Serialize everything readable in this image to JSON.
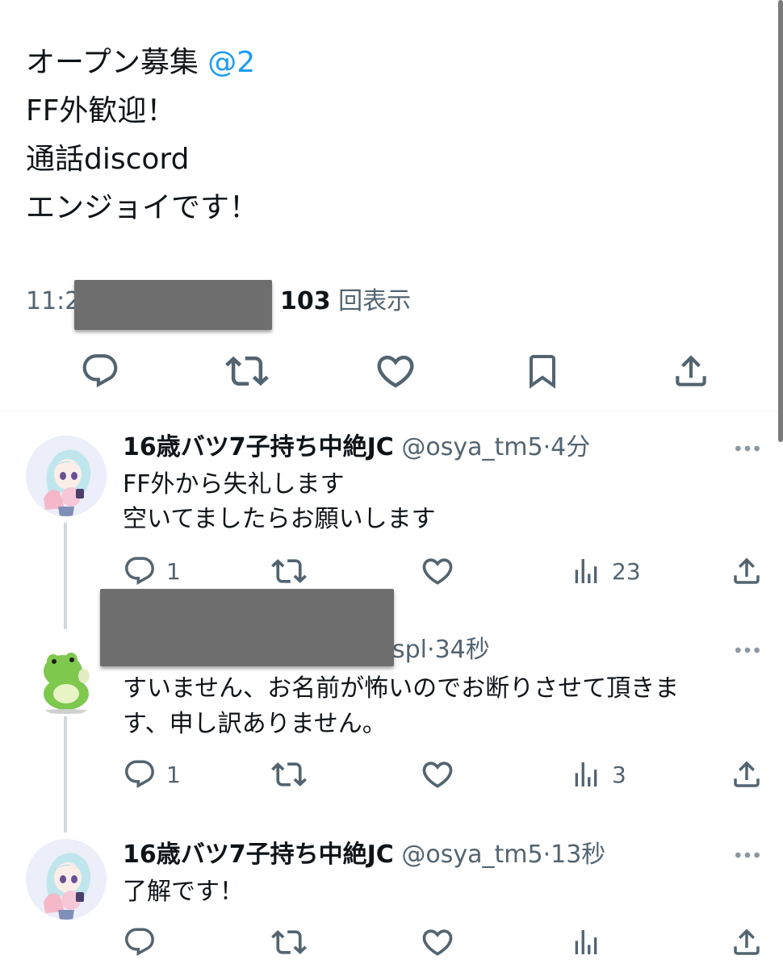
{
  "tweet": {
    "line1_text": "オープン募集",
    "line1_mention": "@2",
    "line2": "FF外歓迎！",
    "line3": "通話discord",
    "line4": "エンジョイです！",
    "time_partial": "11:2",
    "views_count": "103",
    "views_label": "回表示"
  },
  "tweet_actions": [
    {
      "icon": "reply-icon"
    },
    {
      "icon": "retweet-icon"
    },
    {
      "icon": "like-icon"
    },
    {
      "icon": "bookmark-icon"
    },
    {
      "icon": "share-icon"
    }
  ],
  "replies": [
    {
      "name": "16歳バツ7子持ち中絶JC",
      "handle": "@osya_tm5",
      "dot": "·",
      "time": "4分",
      "lines": [
        "FF外から失礼します",
        "空いてましたらお願いします"
      ],
      "reply_count": "1",
      "view_count": "23",
      "avatar": "anime-girl-avatar"
    },
    {
      "name": "",
      "handle": "spl",
      "dot": "·",
      "time": "34秒",
      "lines": [
        "すいません、お名前が怖いのでお断りさせて頂きま",
        "す、申し訳ありません。"
      ],
      "reply_count": "1",
      "view_count": "3",
      "avatar": "green-frog-avatar"
    },
    {
      "name": "16歳バツ7子持ち中絶JC",
      "handle": "@osya_tm5",
      "dot": "·",
      "time": "13秒",
      "lines": [
        "了解です！"
      ],
      "reply_count": "",
      "view_count": "",
      "avatar": "anime-girl-avatar"
    }
  ],
  "colors": {
    "text": "#0f1419",
    "secondary": "#536471",
    "link": "#1d9bf0",
    "redaction": "#6e6e6e",
    "thread_line": "#cfd9de"
  }
}
